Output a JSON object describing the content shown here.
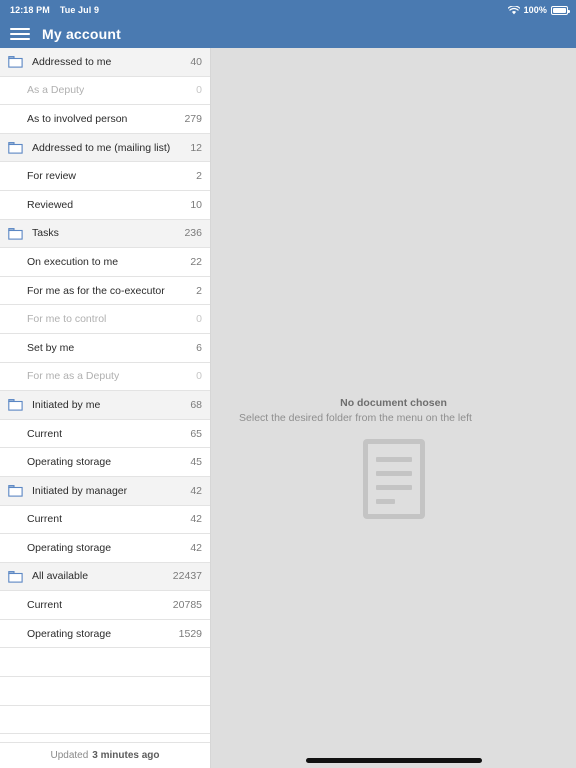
{
  "status_bar": {
    "time": "12:18 PM",
    "date": "Tue Jul 9",
    "wifi_icon": "wifi-icon",
    "battery_percent": "100%",
    "battery_icon": "battery-full-icon"
  },
  "app_bar": {
    "menu_icon": "hamburger-menu-icon",
    "title": "My account",
    "background_color": "#4a7ab1"
  },
  "sidebar": {
    "folder_icon": "folder-icon",
    "rows": [
      {
        "label": "Addressed to me",
        "count": "40",
        "type": "folder",
        "disabled": false
      },
      {
        "label": "As a Deputy",
        "count": "0",
        "type": "child",
        "disabled": true
      },
      {
        "label": "As to involved person",
        "count": "279",
        "type": "child",
        "disabled": false
      },
      {
        "label": "Addressed to me (mailing list)",
        "count": "12",
        "type": "folder",
        "disabled": false
      },
      {
        "label": "For review",
        "count": "2",
        "type": "child",
        "disabled": false
      },
      {
        "label": "Reviewed",
        "count": "10",
        "type": "child",
        "disabled": false
      },
      {
        "label": "Tasks",
        "count": "236",
        "type": "folder",
        "disabled": false
      },
      {
        "label": "On execution to me",
        "count": "22",
        "type": "child",
        "disabled": false
      },
      {
        "label": "For me as for the co-executor",
        "count": "2",
        "type": "child",
        "disabled": false
      },
      {
        "label": "For me to control",
        "count": "0",
        "type": "child",
        "disabled": true
      },
      {
        "label": "Set by me",
        "count": "6",
        "type": "child",
        "disabled": false
      },
      {
        "label": "For me as a Deputy",
        "count": "0",
        "type": "child",
        "disabled": true
      },
      {
        "label": "Initiated by me",
        "count": "68",
        "type": "folder",
        "disabled": false
      },
      {
        "label": "Current",
        "count": "65",
        "type": "child",
        "disabled": false
      },
      {
        "label": "Operating storage",
        "count": "45",
        "type": "child",
        "disabled": false
      },
      {
        "label": "Initiated by manager",
        "count": "42",
        "type": "folder",
        "disabled": false
      },
      {
        "label": "Current",
        "count": "42",
        "type": "child",
        "disabled": false
      },
      {
        "label": "Operating storage",
        "count": "42",
        "type": "child",
        "disabled": false
      },
      {
        "label": "All available",
        "count": "22437",
        "type": "folder",
        "disabled": false
      },
      {
        "label": "Current",
        "count": "20785",
        "type": "child",
        "disabled": false
      },
      {
        "label": "Operating storage",
        "count": "1529",
        "type": "child",
        "disabled": false
      },
      {
        "label": "",
        "count": "",
        "type": "empty",
        "disabled": false
      },
      {
        "label": "",
        "count": "",
        "type": "empty",
        "disabled": false
      },
      {
        "label": "",
        "count": "",
        "type": "empty",
        "disabled": false
      }
    ],
    "footer": {
      "prefix": "Updated",
      "value": "3 minutes ago"
    }
  },
  "detail": {
    "empty_title": "No document chosen",
    "empty_subtitle": "Select the desired folder from the menu on the left",
    "document_icon": "document-placeholder-icon",
    "background_color": "#dedede"
  },
  "home_indicator": "home-indicator"
}
